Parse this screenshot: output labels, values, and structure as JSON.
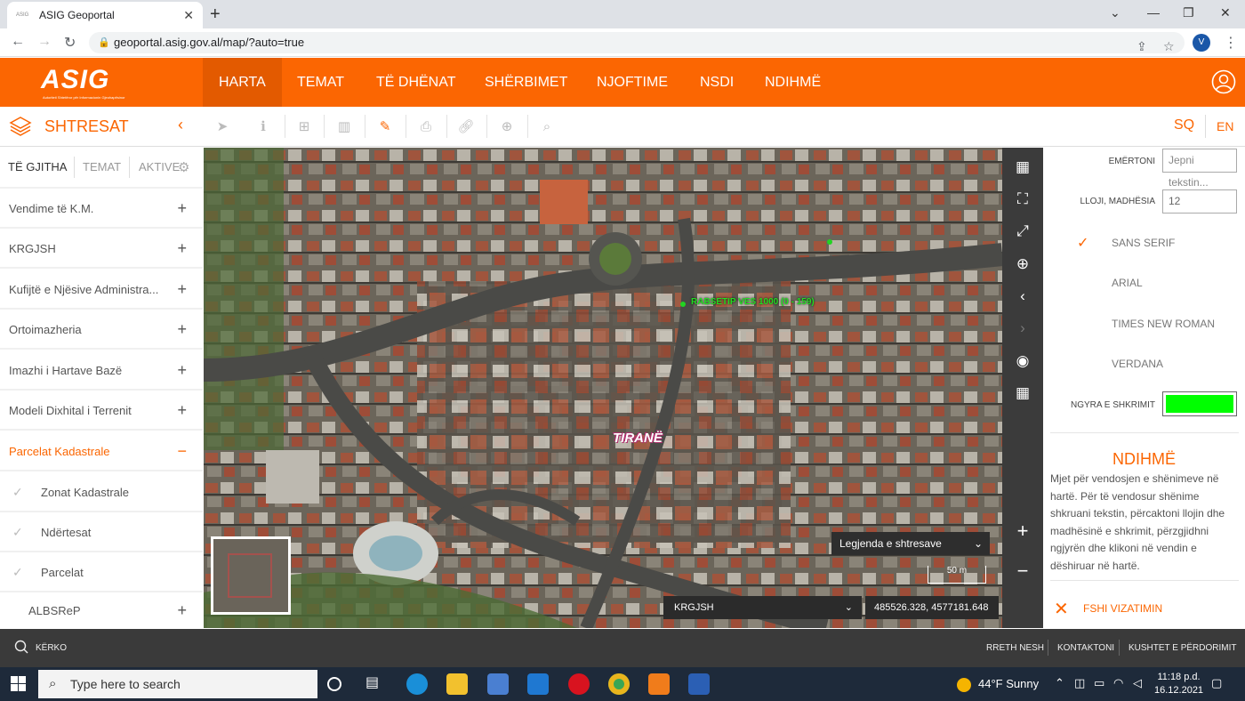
{
  "browser": {
    "tab_title": "ASIG Geoportal",
    "url": "geoportal.asig.gov.al/map/?auto=true",
    "profile_initial": "V"
  },
  "header": {
    "logo_text": "ASIG",
    "logo_subtext": "Autoriteti Shtetëror për Informacionin Gjeohapësinor",
    "nav": [
      "HARTA",
      "TEMAT",
      "TË DHËNAT",
      "SHËRBIMET",
      "NJOFTIME",
      "NSDI",
      "NDIHMË"
    ]
  },
  "toolbar": {
    "panel_title": "SHTRESAT",
    "lang_sq": "SQ",
    "lang_en": "EN"
  },
  "sidebar": {
    "tabs": [
      "TË GJITHA",
      "TEMAT",
      "AKTIVE"
    ],
    "items": [
      {
        "label": "Vendime të K.M.",
        "sign": "+"
      },
      {
        "label": "KRGJSH",
        "sign": "+"
      },
      {
        "label": "Kufijtë e Njësive Administra...",
        "sign": "+"
      },
      {
        "label": "Ortoimazheria",
        "sign": "+"
      },
      {
        "label": "Imazhi i Hartave Bazë",
        "sign": "+"
      },
      {
        "label": "Modeli Dixhital i Terrenit",
        "sign": "+"
      },
      {
        "label": "Parcelat Kadastrale",
        "sign": "−"
      }
    ],
    "subitems": [
      "Zonat Kadastrale",
      "Ndërtesat",
      "Parcelat"
    ],
    "last_item": {
      "label": "ALBSReP",
      "sign": "+"
    }
  },
  "map": {
    "label_point": "RABSETIP VES 1000 (0 - 159)",
    "place_label": "TIRANË",
    "legend_label": "Legjenda e shtresave",
    "scale_label": "50 m",
    "crs_select": "KRGJSH",
    "coordinates": "485526.328, 4577181.648"
  },
  "drawing_panel": {
    "name_label": "EMËRTONI",
    "name_placeholder": "Jepni tekstin...",
    "size_label": "LLOJI, MADHËSIA",
    "size_value": "12",
    "fonts": [
      "SANS SERIF",
      "ARIAL",
      "TIMES NEW ROMAN",
      "VERDANA"
    ],
    "selected_font": "SANS SERIF",
    "color_label": "NGYRA E SHKRIMIT",
    "color_value": "#00ff00",
    "help_title": "NDIHMË",
    "help_text": "Mjet për vendosjen e shënimeve në hartë. Për të vendosur shënime shkruani tekstin, përcaktoni llojin dhe madhësinë e shkrimit, përzgjidhni ngjyrën dhe klikoni në vendin e dëshiruar në hartë.",
    "clear_label": "FSHI VIZATIMIN"
  },
  "footer": {
    "search_label": "KËRKO",
    "links": [
      "RRETH NESH",
      "KONTAKTONI",
      "KUSHTET E PËRDORIMIT"
    ]
  },
  "taskbar": {
    "search_placeholder": "Type here to search",
    "weather": "44°F  Sunny",
    "time": "11:18 p.d.",
    "date": "16.12.2021"
  }
}
